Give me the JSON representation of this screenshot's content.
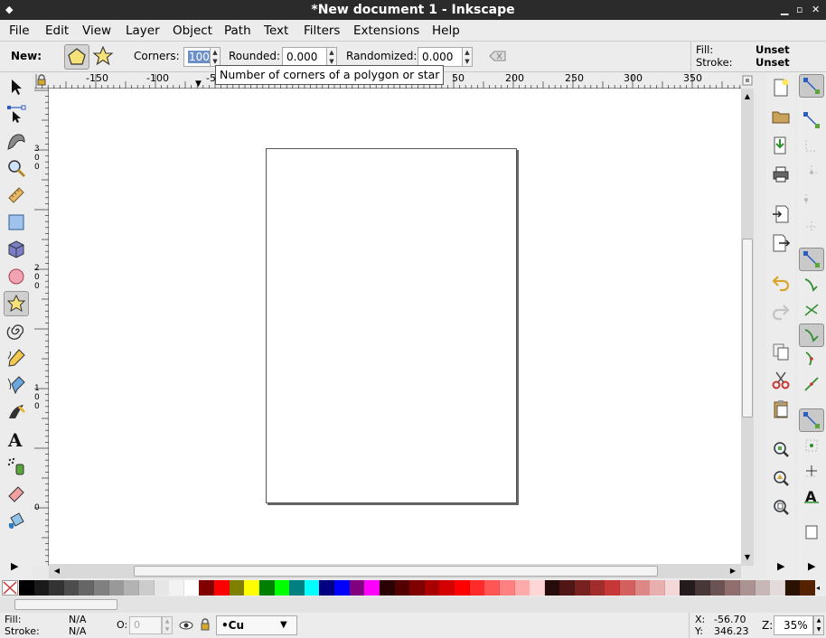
{
  "window": {
    "title": "*New document 1 - Inkscape"
  },
  "menu": [
    "File",
    "Edit",
    "View",
    "Layer",
    "Object",
    "Path",
    "Text",
    "Filters",
    "Extensions",
    "Help"
  ],
  "toolctrl": {
    "new_label": "New:",
    "corners_label": "Corners:",
    "corners_value": "100",
    "rounded_label": "Rounded:",
    "rounded_value": "0.000",
    "randomized_label": "Randomized:",
    "randomized_value": "0.000",
    "fill_label": "Fill:",
    "fill_value": "Unset",
    "stroke_label": "Stroke:",
    "stroke_value": "Unset"
  },
  "tooltip": "Number of corners of a polygon or star",
  "hruler_ticks": [
    "-150",
    "-100",
    "-50",
    "50",
    "200",
    "250",
    "300",
    "350"
  ],
  "vruler_ticks": [
    "300",
    "200",
    "100",
    "0"
  ],
  "status": {
    "fill_label": "Fill:",
    "fill_value": "N/A",
    "stroke_label": "Stroke:",
    "stroke_value": "N/A",
    "opacity_label": "O:",
    "opacity_value": "0",
    "layer_value": "•Cu",
    "x_label": "X:",
    "x_value": "-56.70",
    "y_label": "Y:",
    "y_value": "346.23",
    "zoom_label": "Z:",
    "zoom_value": "35%"
  },
  "palette": [
    "#000000",
    "#1a1a1a",
    "#333333",
    "#4d4d4d",
    "#666666",
    "#808080",
    "#999999",
    "#b3b3b3",
    "#cccccc",
    "#e6e6e6",
    "#f2f2f2",
    "#ffffff",
    "#800000",
    "#ff0000",
    "#808000",
    "#ffff00",
    "#008000",
    "#00ff00",
    "#008080",
    "#00ffff",
    "#000080",
    "#0000ff",
    "#800080",
    "#ff00ff",
    "#2b0000",
    "#550000",
    "#800000",
    "#aa0000",
    "#d40000",
    "#ff0000",
    "#ff2a2a",
    "#ff5555",
    "#ff8080",
    "#ffaaaa",
    "#ffd5d5",
    "#280b0b",
    "#501616",
    "#782121",
    "#a02c2c",
    "#c83737",
    "#d35f5f",
    "#de8787",
    "#e9afaf",
    "#f4d7d7",
    "#241c1c",
    "#483737",
    "#6c5353",
    "#916f6f",
    "#ac9393",
    "#c8b7b7",
    "#e3dbdb",
    "#2b1100",
    "#552200"
  ]
}
